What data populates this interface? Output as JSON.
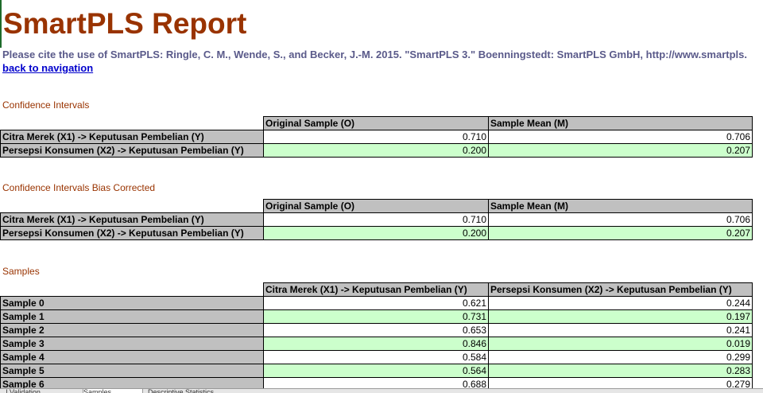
{
  "title": "SmartPLS Report",
  "citation": "Please cite the use of SmartPLS: Ringle, C. M., Wende, S., and Becker, J.-M. 2015. \"SmartPLS 3.\" Boenningstedt: SmartPLS GmbH, http://www.smartpls.",
  "back_link": "back to navigation",
  "sections": {
    "ci": {
      "title": "Confidence Intervals",
      "headers": [
        "Original Sample (O)",
        "Sample Mean (M)"
      ],
      "rows": [
        {
          "label": "Citra Merek (X1) -> Keputusan Pembelian (Y)",
          "values": [
            "0.710",
            "0.706"
          ]
        },
        {
          "label": "Persepsi Konsumen (X2) -> Keputusan Pembelian (Y)",
          "values": [
            "0.200",
            "0.207"
          ]
        }
      ]
    },
    "cibc": {
      "title": "Confidence Intervals Bias Corrected",
      "headers": [
        "Original Sample (O)",
        "Sample Mean (M)"
      ],
      "rows": [
        {
          "label": "Citra Merek (X1) -> Keputusan Pembelian (Y)",
          "values": [
            "0.710",
            "0.706"
          ]
        },
        {
          "label": "Persepsi Konsumen (X2) -> Keputusan Pembelian (Y)",
          "values": [
            "0.200",
            "0.207"
          ]
        }
      ]
    },
    "samples": {
      "title": "Samples",
      "headers": [
        "Citra Merek (X1) -> Keputusan Pembelian (Y)",
        "Persepsi Konsumen (X2) -> Keputusan Pembelian (Y)"
      ],
      "rows": [
        {
          "label": "Sample 0",
          "values": [
            "0.621",
            "0.244"
          ]
        },
        {
          "label": "Sample 1",
          "values": [
            "0.731",
            "0.197"
          ]
        },
        {
          "label": "Sample 2",
          "values": [
            "0.653",
            "0.241"
          ]
        },
        {
          "label": "Sample 3",
          "values": [
            "0.846",
            "0.019"
          ]
        },
        {
          "label": "Sample 4",
          "values": [
            "0.584",
            "0.299"
          ]
        },
        {
          "label": "Sample 5",
          "values": [
            "0.564",
            "0.283"
          ]
        },
        {
          "label": "Sample 6",
          "values": [
            "0.688",
            "0.279"
          ]
        }
      ]
    }
  },
  "sheet_tabs": [
    "...l Validation",
    "Samples",
    "Descriptive Statistics"
  ],
  "colors": {
    "title": "#993300",
    "header_gray": "#c0c0c0",
    "row_green": "#ccffcc",
    "link": "#0000cc"
  }
}
